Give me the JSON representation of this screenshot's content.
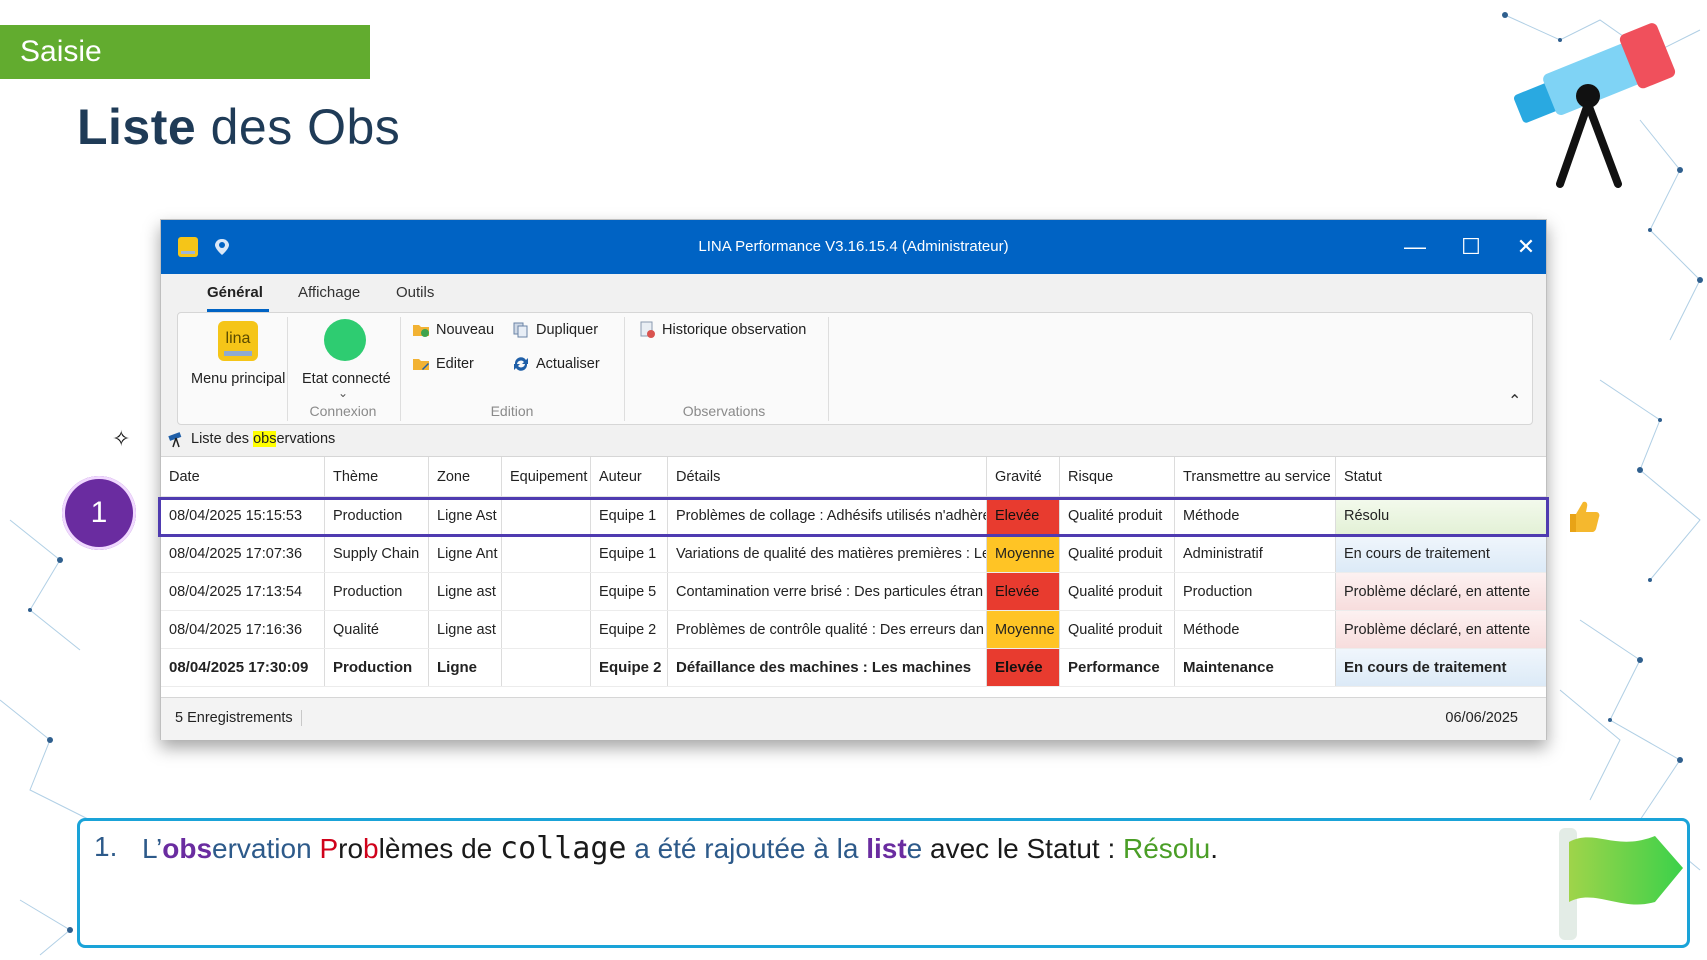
{
  "slide": {
    "section": "Saisie",
    "title_bold": "Liste",
    "title_rest": " des Obs"
  },
  "window": {
    "title": "LINA Performance  V3.16.15.4  (Administrateur)",
    "controls": {
      "minimize": "—",
      "maximize": "☐",
      "close": "✕"
    }
  },
  "ribbon": {
    "tabs": [
      "Général",
      "Affichage",
      "Outils"
    ],
    "active_tab": "Général",
    "logo_text": "lina",
    "menu_principal": "Menu principal",
    "etat_connecte": "Etat connecté",
    "group_connexion": "Connexion",
    "nouveau": "Nouveau",
    "editer": "Editer",
    "dupliquer": "Dupliquer",
    "actualiser": "Actualiser",
    "group_edition": "Edition",
    "historique": "Historique observation",
    "group_observations": "Observations",
    "collapse": "⌃",
    "status_color": "#2ecc71"
  },
  "list_tab": {
    "pre": "Liste des ",
    "highlight": "obs",
    "post": "ervations"
  },
  "table": {
    "headers": [
      "Date",
      "Thème",
      "Zone",
      "Equipement",
      "Auteur",
      "Détails",
      "Gravité",
      "Risque",
      "Transmettre au service",
      "Statut"
    ],
    "rows": [
      [
        "08/04/2025 15:15:53",
        "Production",
        "Ligne Ast",
        "",
        "Equipe 1",
        "Problèmes de collage : Adhésifs utilisés n'adhère",
        "Elevée",
        "Qualité produit",
        "Méthode",
        "Résolu"
      ],
      [
        "08/04/2025 17:07:36",
        "Supply Chain",
        "Ligne Ant",
        "",
        "Equipe 1",
        "Variations de qualité des matières premières : Le",
        "Moyenne",
        "Qualité produit",
        "Administratif",
        "En cours de traitement"
      ],
      [
        "08/04/2025 17:13:54",
        "Production",
        "Ligne ast",
        "",
        "Equipe 5",
        "Contamination verre brisé : Des particules étran",
        "Elevée",
        "Qualité produit",
        "Production",
        "Problème déclaré, en attente"
      ],
      [
        "08/04/2025 17:16:36",
        "Qualité",
        "Ligne ast",
        "",
        "Equipe 2",
        "Problèmes de contrôle qualité : Des erreurs dan",
        "Moyenne",
        "Qualité produit",
        "Méthode",
        "Problème déclaré, en attente"
      ],
      [
        "08/04/2025 17:30:09",
        "Production",
        "Ligne",
        "",
        "Equipe 2",
        "Défaillance des machines : Les machines",
        "Elevée",
        "Performance",
        "Maintenance",
        "En cours de traitement"
      ]
    ]
  },
  "statusbar": {
    "count": "5 Enregistrements",
    "date": "06/06/2025"
  },
  "badge": "1",
  "note": {
    "number": "1.",
    "p1": "L’",
    "p2": "obs",
    "p3": "ervation ",
    "p4": "P",
    "p5": "ro",
    "p6": "b",
    "p7": "lèmes de ",
    "p8": "collage",
    "p9": " a été rajoutée à la ",
    "p10": "list",
    "p11": "e",
    "p12": " avec le Statut : ",
    "p13": "Résolu",
    "p14": "."
  },
  "colors": {
    "accent_green": "#62ac2f",
    "titlebar_blue": "#0063c4",
    "selection_purple": "#4f3bb0",
    "severity_high": "#e83b2f",
    "severity_medium": "#ffc425",
    "note_border": "#1aa3d8"
  }
}
